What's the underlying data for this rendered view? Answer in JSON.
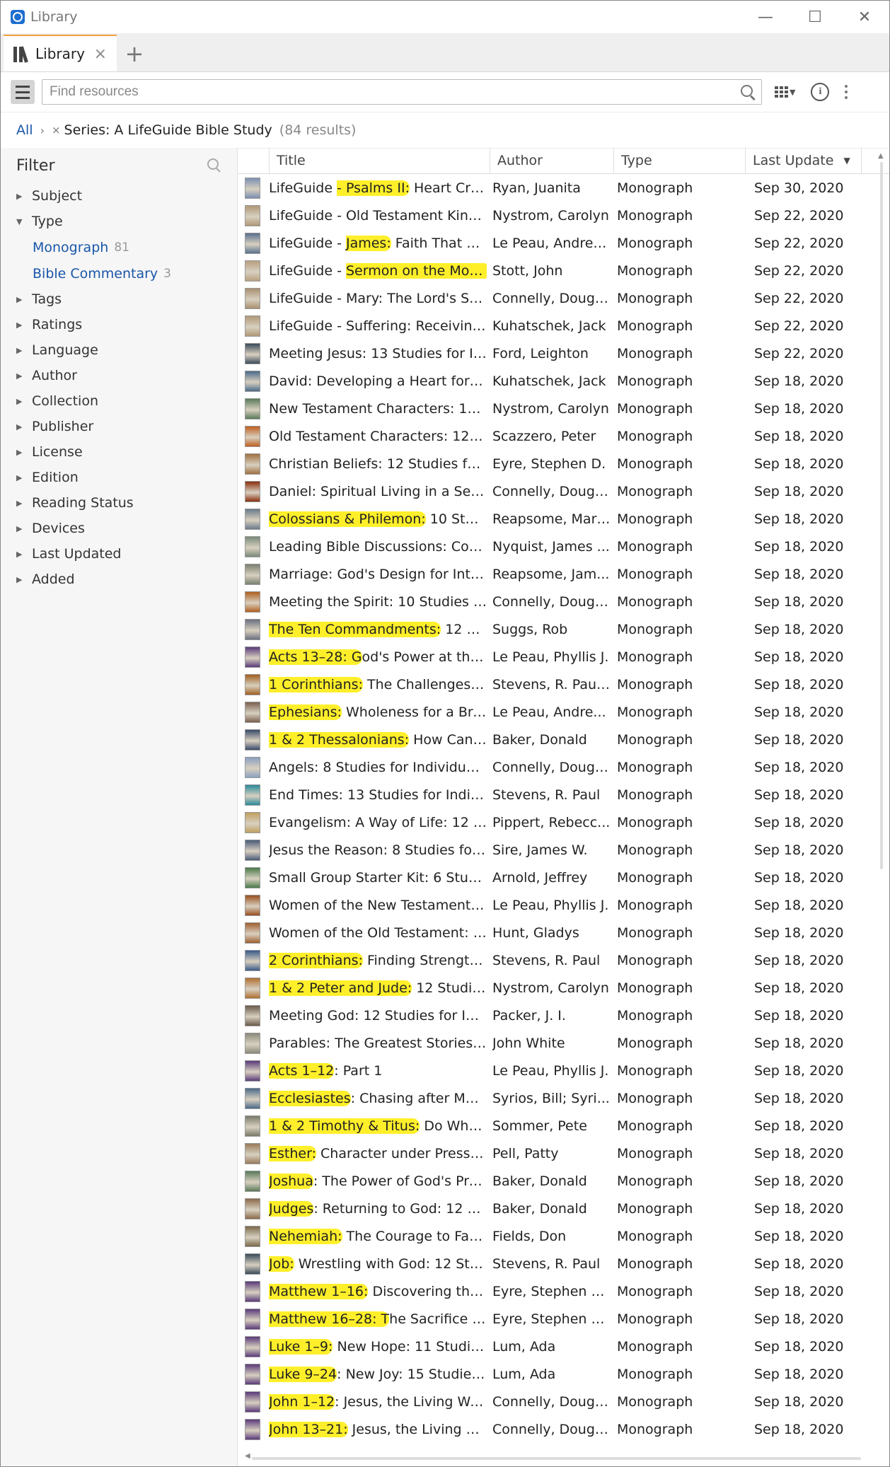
{
  "window": {
    "title": "Library"
  },
  "tab": {
    "label": "Library",
    "close": "×",
    "add": "+"
  },
  "search": {
    "placeholder": "Find resources"
  },
  "breadcrumb": {
    "all": "All",
    "sep": "›",
    "remove": "×",
    "series": "Series: A LifeGuide Bible Study",
    "count": "(84 results)"
  },
  "filter": {
    "title": "Filter",
    "facets": [
      {
        "label": "Subject",
        "expanded": false
      },
      {
        "label": "Type",
        "expanded": true,
        "items": [
          {
            "label": "Monograph",
            "count": "81"
          },
          {
            "label": "Bible Commentary",
            "count": "3"
          }
        ]
      },
      {
        "label": "Tags",
        "expanded": false
      },
      {
        "label": "Ratings",
        "expanded": false
      },
      {
        "label": "Language",
        "expanded": false
      },
      {
        "label": "Author",
        "expanded": false
      },
      {
        "label": "Collection",
        "expanded": false
      },
      {
        "label": "Publisher",
        "expanded": false
      },
      {
        "label": "License",
        "expanded": false
      },
      {
        "label": "Edition",
        "expanded": false
      },
      {
        "label": "Reading Status",
        "expanded": false
      },
      {
        "label": "Devices",
        "expanded": false
      },
      {
        "label": "Last Updated",
        "expanded": false
      },
      {
        "label": "Added",
        "expanded": false
      }
    ]
  },
  "columns": {
    "title": "Title",
    "author": "Author",
    "type": "Type",
    "update": "Last Update"
  },
  "colors": {
    "highlight": "#ffef2a",
    "link": "#1a56a8",
    "accent_tab": "#f0a040"
  },
  "rows": [
    {
      "hl": "- Psalms II:",
      "rest": " Heart Crie...",
      "pre": "LifeGuide ",
      "author": "Ryan, Juanita",
      "type": "Monograph",
      "date": "Sep 30, 2020",
      "cover": "#7a8fb0"
    },
    {
      "pre": "LifeGuide - Old Testament Kings...",
      "hl": "",
      "rest": "",
      "author": "Nystrom, Carolyn",
      "type": "Monograph",
      "date": "Sep 22, 2020",
      "cover": "#b09878"
    },
    {
      "pre": "LifeGuide - ",
      "hl": "James:",
      "rest": " Faith That W...",
      "author": "Le Peau, Andrew T.",
      "type": "Monograph",
      "date": "Sep 22, 2020",
      "cover": "#5a7090"
    },
    {
      "pre": "LifeGuide - ",
      "hl": "Sermon on the Mou...",
      "rest": "",
      "author": "Stott, John",
      "type": "Monograph",
      "date": "Sep 22, 2020",
      "cover": "#b8a080"
    },
    {
      "pre": "LifeGuide - Mary: The Lord's Ser...",
      "hl": "",
      "rest": "",
      "author": "Connelly, Douglas",
      "type": "Monograph",
      "date": "Sep 22, 2020",
      "cover": "#a89070"
    },
    {
      "pre": "LifeGuide - Suffering: Receiving ...",
      "hl": "",
      "rest": "",
      "author": "Kuhatschek, Jack",
      "type": "Monograph",
      "date": "Sep 22, 2020",
      "cover": "#b09878"
    },
    {
      "pre": "Meeting Jesus: 13 Studies for In...",
      "hl": "",
      "rest": "",
      "author": "Ford, Leighton",
      "type": "Monograph",
      "date": "Sep 22, 2020",
      "cover": "#3a4a5a"
    },
    {
      "pre": "David: Developing a Heart for G...",
      "hl": "",
      "rest": "",
      "author": "Kuhatschek, Jack",
      "type": "Monograph",
      "date": "Sep 18, 2020",
      "cover": "#4a6a8a"
    },
    {
      "pre": "New Testament Characters: 10 S...",
      "hl": "",
      "rest": "",
      "author": "Nystrom, Carolyn",
      "type": "Monograph",
      "date": "Sep 18, 2020",
      "cover": "#5a7a5a"
    },
    {
      "pre": "Old Testament Characters: 12 St...",
      "hl": "",
      "rest": "",
      "author": "Scazzero, Peter",
      "type": "Monograph",
      "date": "Sep 18, 2020",
      "cover": "#c06020"
    },
    {
      "pre": "Christian Beliefs: 12 Studies for I...",
      "hl": "",
      "rest": "",
      "author": "Eyre, Stephen D.",
      "type": "Monograph",
      "date": "Sep 18, 2020",
      "cover": "#a07040"
    },
    {
      "pre": "Daniel: Spiritual Living in a Secu...",
      "hl": "",
      "rest": "",
      "author": "Connelly, Douglas",
      "type": "Monograph",
      "date": "Sep 18, 2020",
      "cover": "#8a3010"
    },
    {
      "pre": "",
      "hl": "Colossians & Philemon:",
      "rest": " 10 Studi...",
      "author": "Reapsome, Mart...",
      "type": "Monograph",
      "date": "Sep 18, 2020",
      "cover": "#6a7a8a"
    },
    {
      "pre": "Leading Bible Discussions: Com...",
      "hl": "",
      "rest": "",
      "author": "Nyquist, James ...",
      "type": "Monograph",
      "date": "Sep 18, 2020",
      "cover": "#7a8a7a"
    },
    {
      "pre": "Marriage: God's Design for Intim...",
      "hl": "",
      "rest": "",
      "author": "Reapsome, Jam...",
      "type": "Monograph",
      "date": "Sep 18, 2020",
      "cover": "#7a8070"
    },
    {
      "pre": "Meeting the Spirit: 10 Studies fo...",
      "hl": "",
      "rest": "",
      "author": "Connelly, Douglas",
      "type": "Monograph",
      "date": "Sep 18, 2020",
      "cover": "#b06020"
    },
    {
      "pre": "",
      "hl": "The Ten Commandments:",
      "rest": " 12 St...",
      "author": "Suggs, Rob",
      "type": "Monograph",
      "date": "Sep 18, 2020",
      "cover": "#6a7080"
    },
    {
      "pre": "",
      "hl": "Acts 13–28: G",
      "rest": "od's Power at the ...",
      "author": "Le Peau, Phyllis J.",
      "type": "Monograph",
      "date": "Sep 18, 2020",
      "cover": "#5a3a7a"
    },
    {
      "pre": "",
      "hl": "1 Corinthians:",
      "rest": " The Challenges of...",
      "author": "Stevens, R. Paul;...",
      "type": "Monograph",
      "date": "Sep 18, 2020",
      "cover": "#a06020"
    },
    {
      "pre": "",
      "hl": "Ephesians:",
      "rest": " Wholeness for a Bro...",
      "author": "Le Peau, Andre...",
      "type": "Monograph",
      "date": "Sep 18, 2020",
      "cover": "#7a6050"
    },
    {
      "pre": "",
      "hl": "1 & 2 Thessalonians:",
      "rest": " How Can I ...",
      "author": "Baker, Donald",
      "type": "Monograph",
      "date": "Sep 18, 2020",
      "cover": "#3a4a6a"
    },
    {
      "pre": "Angels: 8 Studies for Individuals...",
      "hl": "",
      "rest": "",
      "author": "Connelly, Douglas",
      "type": "Monograph",
      "date": "Sep 18, 2020",
      "cover": "#8aa0c0"
    },
    {
      "pre": "End Times: 13 Studies for Indivi...",
      "hl": "",
      "rest": "",
      "author": "Stevens, R. Paul",
      "type": "Monograph",
      "date": "Sep 18, 2020",
      "cover": "#2a8a9a"
    },
    {
      "pre": "Evangelism: A Way of Life: 12 St...",
      "hl": "",
      "rest": "",
      "author": "Pippert, Rebecc...",
      "type": "Monograph",
      "date": "Sep 18, 2020",
      "cover": "#c0a060"
    },
    {
      "pre": "Jesus the Reason: 8 Studies for I...",
      "hl": "",
      "rest": "",
      "author": "Sire, James W.",
      "type": "Monograph",
      "date": "Sep 18, 2020",
      "cover": "#4a5a7a"
    },
    {
      "pre": "Small Group Starter Kit: 6 Studi...",
      "hl": "",
      "rest": "",
      "author": "Arnold, Jeffrey",
      "type": "Monograph",
      "date": "Sep 18, 2020",
      "cover": "#4a7a4a"
    },
    {
      "pre": "Women of the New Testament: ...",
      "hl": "",
      "rest": "",
      "author": "Le Peau, Phyllis J.",
      "type": "Monograph",
      "date": "Sep 18, 2020",
      "cover": "#9a5020"
    },
    {
      "pre": "Women of the Old Testament: 1...",
      "hl": "",
      "rest": "",
      "author": "Hunt, Gladys",
      "type": "Monograph",
      "date": "Sep 18, 2020",
      "cover": "#a06030"
    },
    {
      "pre": "",
      "hl": "2 Corinthians:",
      "rest": " Finding Strength ...",
      "author": "Stevens, R. Paul",
      "type": "Monograph",
      "date": "Sep 18, 2020",
      "cover": "#3a5a8a"
    },
    {
      "pre": "",
      "hl": "1 & 2 Peter and Jude:",
      "rest": " 12 Studies...",
      "author": "Nystrom, Carolyn",
      "type": "Monograph",
      "date": "Sep 18, 2020",
      "cover": "#b07030"
    },
    {
      "pre": "Meeting God: 12 Studies for Indi...",
      "hl": "",
      "rest": "",
      "author": "Packer, J. I.",
      "type": "Monograph",
      "date": "Sep 18, 2020",
      "cover": "#6a5a4a"
    },
    {
      "pre": "Parables: The Greatest Stories E...",
      "hl": "",
      "rest": "",
      "author": "John White",
      "type": "Monograph",
      "date": "Sep 18, 2020",
      "cover": "#8a8a7a"
    },
    {
      "pre": "",
      "hl": "Acts 1–12",
      "rest": ": Part 1",
      "author": "Le Peau, Phyllis J.",
      "type": "Monograph",
      "date": "Sep 18, 2020",
      "cover": "#5a3a7a"
    },
    {
      "pre": "",
      "hl": "Ecclesiastes",
      "rest": ": Chasing after Mean...",
      "author": "Syrios, Bill; Syri...",
      "type": "Monograph",
      "date": "Sep 18, 2020",
      "cover": "#4a6a8a"
    },
    {
      "pre": "",
      "hl": "1 & 2 Timothy & Titus:",
      "rest": " Do What Y...",
      "author": "Sommer, Pete",
      "type": "Monograph",
      "date": "Sep 18, 2020",
      "cover": "#7a7a6a"
    },
    {
      "pre": "",
      "hl": "Esther:",
      "rest": " Character under Pressur...",
      "author": "Pell, Patty",
      "type": "Monograph",
      "date": "Sep 18, 2020",
      "cover": "#9a7a5a"
    },
    {
      "pre": "",
      "hl": "Joshua",
      "rest": ": The Power of God's Pro...",
      "author": "Baker, Donald",
      "type": "Monograph",
      "date": "Sep 18, 2020",
      "cover": "#5a7a5a"
    },
    {
      "pre": "",
      "hl": "Judges",
      "rest": ": Returning to God: 12 St...",
      "author": "Baker, Donald",
      "type": "Monograph",
      "date": "Sep 18, 2020",
      "cover": "#8a6a4a"
    },
    {
      "pre": "",
      "hl": "Nehemiah:",
      "rest": " The Courage to Face...",
      "author": "Fields, Don",
      "type": "Monograph",
      "date": "Sep 18, 2020",
      "cover": "#7a6a4a"
    },
    {
      "pre": "",
      "hl": "Job:",
      "rest": " Wrestling with God: 12 Stu...",
      "author": "Stevens, R. Paul",
      "type": "Monograph",
      "date": "Sep 18, 2020",
      "cover": "#3a4a5a"
    },
    {
      "pre": "",
      "hl": "Matthew 1–16:",
      "rest": " Discovering the ...",
      "author": "Eyre, Stephen D....",
      "type": "Monograph",
      "date": "Sep 18, 2020",
      "cover": "#5a3a7a"
    },
    {
      "pre": "",
      "hl": "Matthew 16–28: T",
      "rest": "he Sacrifice of ...",
      "author": "Eyre, Stephen D....",
      "type": "Monograph",
      "date": "Sep 18, 2020",
      "cover": "#5a3a7a"
    },
    {
      "pre": "",
      "hl": "Luke 1–9:",
      "rest": " New Hope: 11 Studies...",
      "author": "Lum, Ada",
      "type": "Monograph",
      "date": "Sep 18, 2020",
      "cover": "#5a3a7a"
    },
    {
      "pre": "",
      "hl": "Luke 9–24",
      "rest": ": New Joy: 15 Studies ...",
      "author": "Lum, Ada",
      "type": "Monograph",
      "date": "Sep 18, 2020",
      "cover": "#5a3a7a"
    },
    {
      "pre": "",
      "hl": "John 1–12",
      "rest": ": Jesus, the Living Wo...",
      "author": "Connelly, Douglas",
      "type": "Monograph",
      "date": "Sep 18, 2020",
      "cover": "#5a3a7a"
    },
    {
      "pre": "",
      "hl": "John 13–21:",
      "rest": " Jesus, the Living W...",
      "author": "Connelly, Douglas",
      "type": "Monograph",
      "date": "Sep 18, 2020",
      "cover": "#5a3a7a"
    }
  ]
}
